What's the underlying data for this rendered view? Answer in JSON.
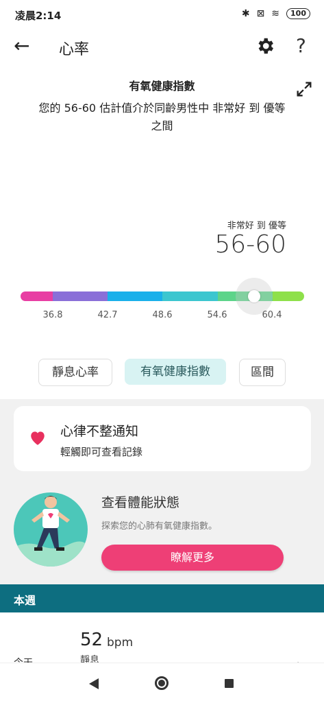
{
  "status": {
    "time": "凌晨2:14",
    "battery": "100",
    "bluetooth_icon": "✱",
    "sim_icon": "⊠",
    "wifi_icon": "≋"
  },
  "appbar": {
    "title": "心率",
    "back_icon": "←",
    "help_icon": "?"
  },
  "header": {
    "title": "有氧健康指數",
    "description": "您的 56-60 估計值介於同齡男性中 非常好 到 優等 之間"
  },
  "current": {
    "label": "非常好 到 優等",
    "value": "56-60"
  },
  "scale": {
    "ticks": [
      "36.8",
      "42.7",
      "48.6",
      "54.6",
      "60.4"
    ],
    "colors": [
      "#e83ea3",
      "#8a6fd8",
      "#1ab0ea",
      "#3cc6cf",
      "#5dd48a",
      "#8ee04a"
    ]
  },
  "tabs": [
    {
      "label": "靜息心率"
    },
    {
      "label": "有氧健康指數",
      "active": true
    },
    {
      "label": "區間"
    }
  ],
  "notification_card": {
    "title": "心律不整通知",
    "subtitle": "輕觸即可查看記錄"
  },
  "promo": {
    "title": "查看體能狀態",
    "description": "探索您的心肺有氧健康指數。",
    "button": "瞭解更多"
  },
  "week": {
    "title": "本週",
    "row": {
      "day": "今天",
      "value": "52",
      "unit": "bpm",
      "sub": "靜息"
    }
  },
  "colors": {
    "accent": "#ee3f76",
    "teal": "#0d6e80",
    "tab_active_bg": "#d8f3f3"
  }
}
